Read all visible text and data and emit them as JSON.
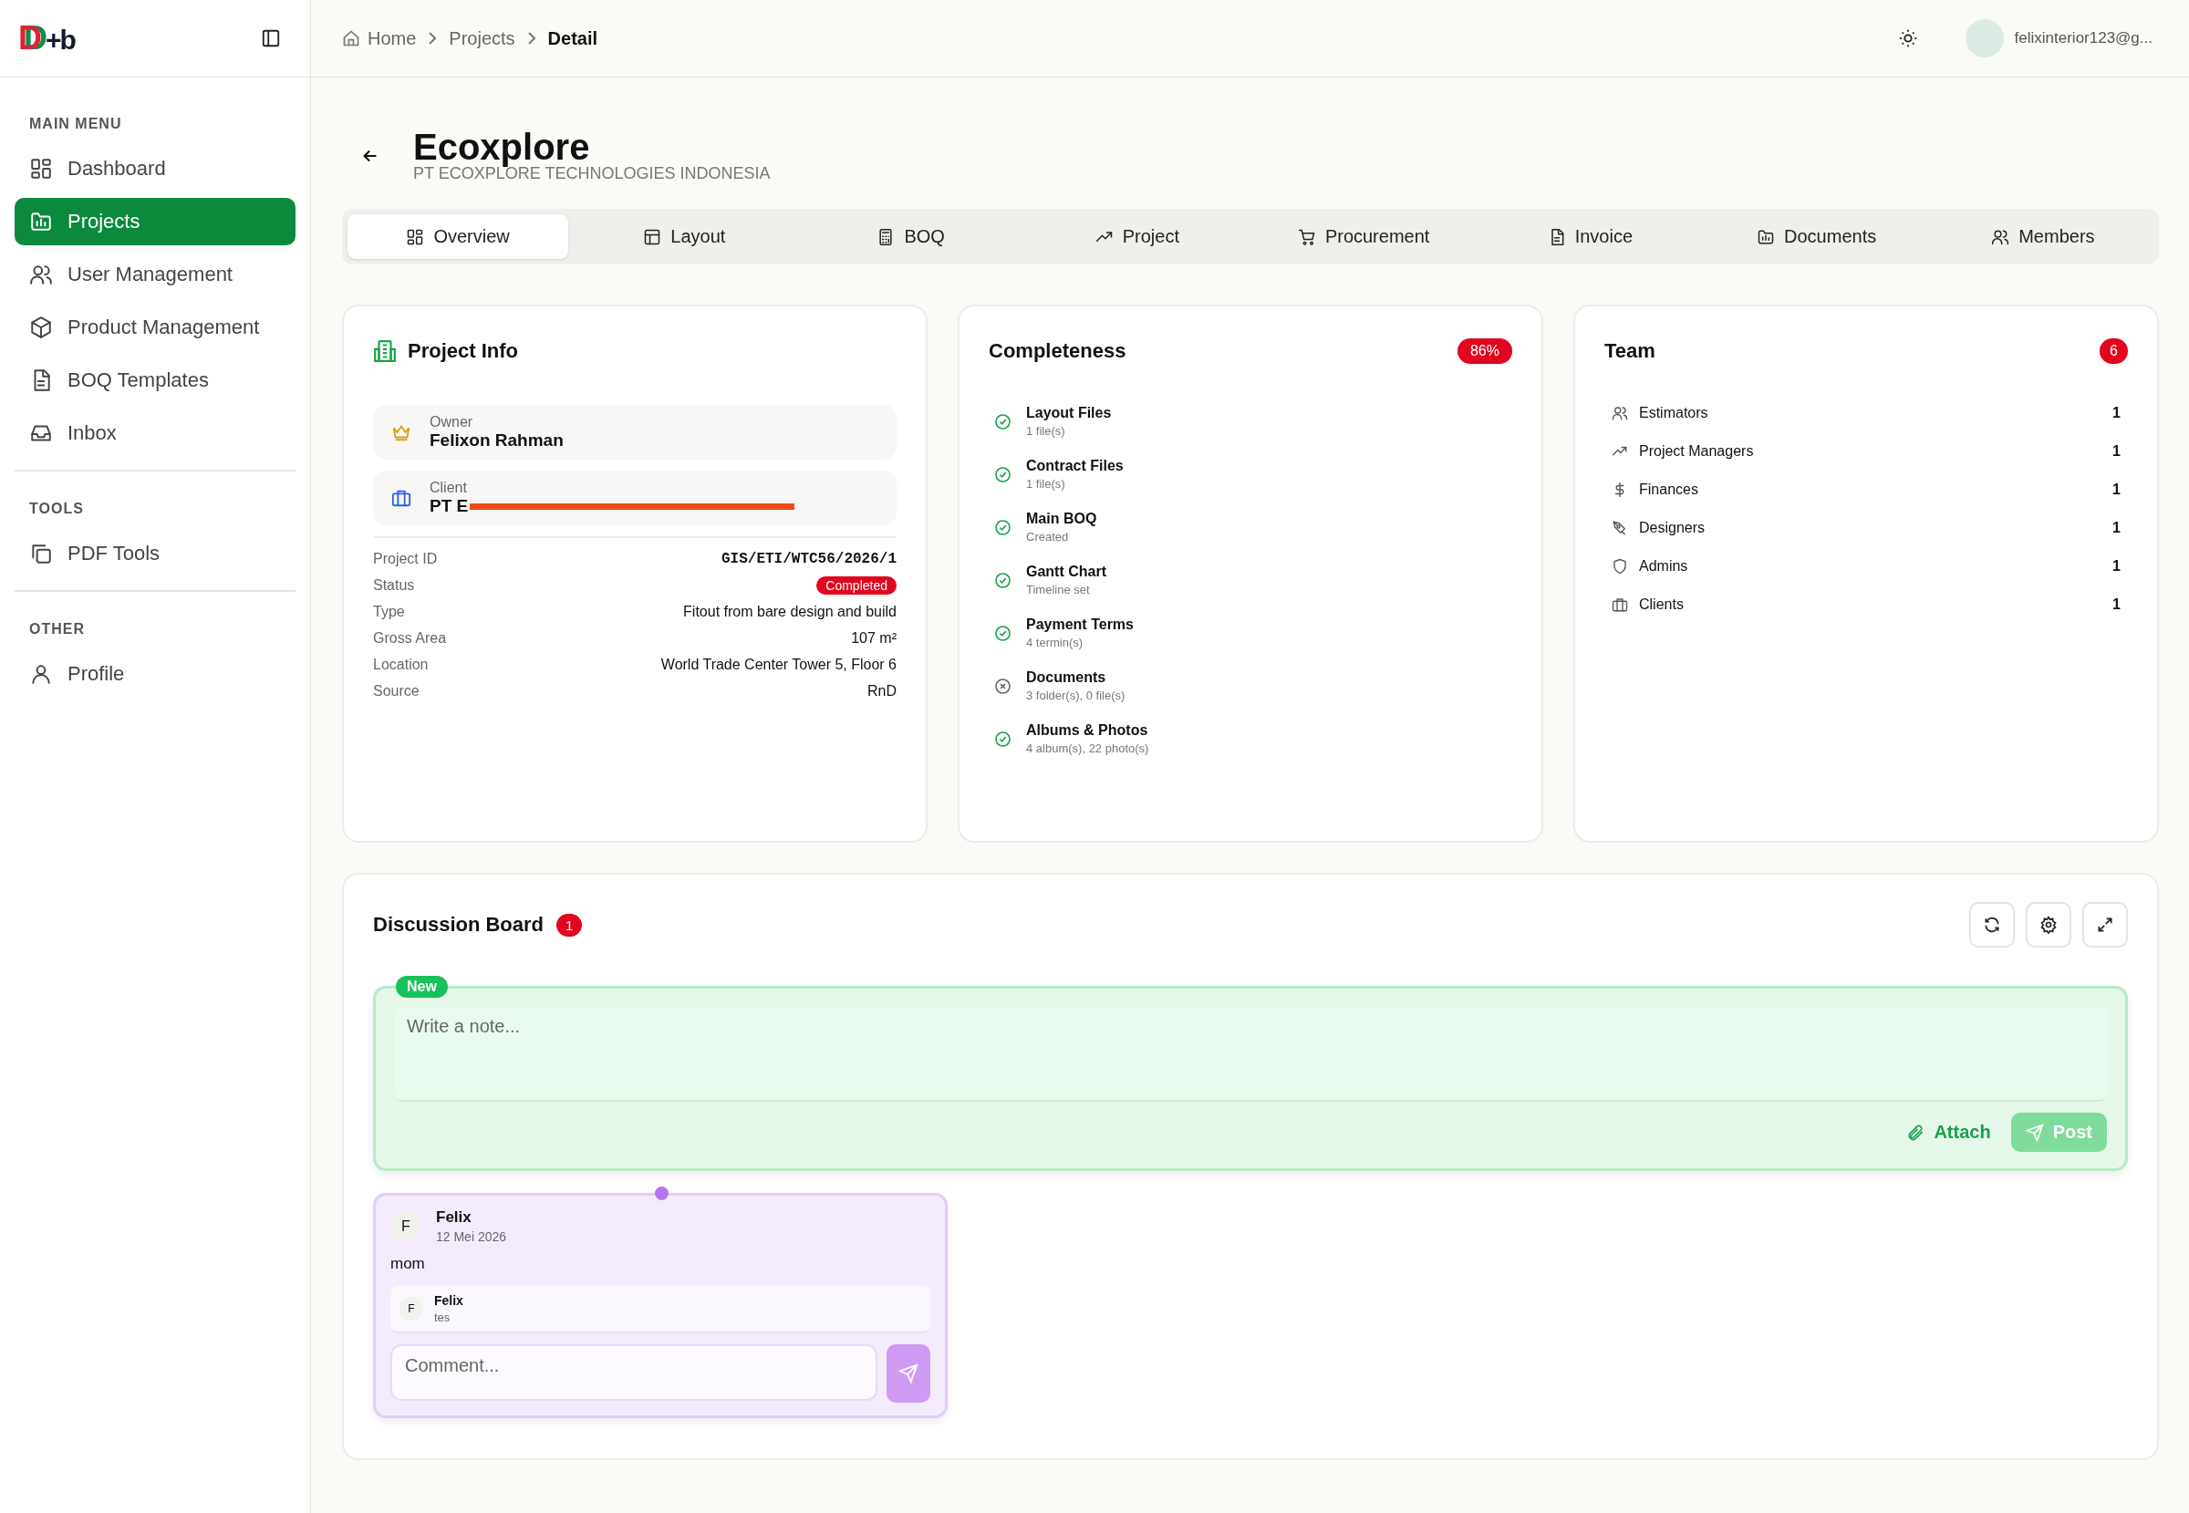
{
  "logo": {
    "mark": "D",
    "suffix": "+b"
  },
  "sidebar": {
    "sections": [
      {
        "heading": "MAIN MENU",
        "items": [
          {
            "label": "Dashboard",
            "selected": false
          },
          {
            "label": "Projects",
            "selected": true
          },
          {
            "label": "User Management",
            "selected": false
          },
          {
            "label": "Product Management",
            "selected": false
          },
          {
            "label": "BOQ Templates",
            "selected": false
          },
          {
            "label": "Inbox",
            "selected": false
          }
        ]
      },
      {
        "heading": "TOOLS",
        "items": [
          {
            "label": "PDF Tools",
            "selected": false
          }
        ]
      },
      {
        "heading": "OTHER",
        "items": [
          {
            "label": "Profile",
            "selected": false
          }
        ]
      }
    ]
  },
  "breadcrumb": [
    {
      "label": "Home",
      "current": false
    },
    {
      "label": "Projects",
      "current": false
    },
    {
      "label": "Detail",
      "current": true
    }
  ],
  "user": {
    "email": "felixinterior123@g..."
  },
  "project": {
    "title": "Ecoxplore",
    "subtitle": "PT ECOXPLORE TECHNOLOGIES INDONESIA"
  },
  "tabs": [
    {
      "label": "Overview",
      "selected": true
    },
    {
      "label": "Layout",
      "selected": false
    },
    {
      "label": "BOQ",
      "selected": false
    },
    {
      "label": "Project",
      "selected": false
    },
    {
      "label": "Procurement",
      "selected": false
    },
    {
      "label": "Invoice",
      "selected": false
    },
    {
      "label": "Documents",
      "selected": false
    },
    {
      "label": "Members",
      "selected": false
    }
  ],
  "project_info": {
    "title": "Project Info",
    "owner": {
      "label": "Owner",
      "value": "Felixon Rahman"
    },
    "client": {
      "label": "Client",
      "value": "PT E"
    },
    "fields": [
      {
        "label": "Project ID",
        "value": "GIS/ETI/WTC56/2026/1",
        "kind": "mono"
      },
      {
        "label": "Status",
        "value": "Completed",
        "kind": "badge"
      },
      {
        "label": "Type",
        "value": "Fitout from bare design and build",
        "kind": "text"
      },
      {
        "label": "Gross Area",
        "value": "107 m²",
        "kind": "text"
      },
      {
        "label": "Location",
        "value": "World Trade Center Tower 5, Floor 6",
        "kind": "text"
      },
      {
        "label": "Source",
        "value": "RnD",
        "kind": "text"
      }
    ]
  },
  "completeness": {
    "title": "Completeness",
    "badge": "86%",
    "items": [
      {
        "title": "Layout Files",
        "detail": "1 file(s)",
        "done": true
      },
      {
        "title": "Contract Files",
        "detail": "1 file(s)",
        "done": true
      },
      {
        "title": "Main BOQ",
        "detail": "Created",
        "done": true
      },
      {
        "title": "Gantt Chart",
        "detail": "Timeline set",
        "done": true
      },
      {
        "title": "Payment Terms",
        "detail": "4 termin(s)",
        "done": true
      },
      {
        "title": "Documents",
        "detail": "3 folder(s), 0 file(s)",
        "done": false
      },
      {
        "title": "Albums & Photos",
        "detail": "4 album(s), 22 photo(s)",
        "done": true
      }
    ]
  },
  "team": {
    "title": "Team",
    "count": "6",
    "roles": [
      {
        "label": "Estimators",
        "count": "1"
      },
      {
        "label": "Project Managers",
        "count": "1"
      },
      {
        "label": "Finances",
        "count": "1"
      },
      {
        "label": "Designers",
        "count": "1"
      },
      {
        "label": "Admins",
        "count": "1"
      },
      {
        "label": "Clients",
        "count": "1"
      }
    ]
  },
  "discussion": {
    "title": "Discussion Board",
    "count": "1",
    "composer": {
      "badge": "New",
      "placeholder": "Write a note...",
      "attach": "Attach",
      "post": "Post"
    },
    "notes": [
      {
        "avatar": "F",
        "author": "Felix",
        "date": "12 Mei 2026",
        "body": "mom",
        "comments": [
          {
            "avatar": "F",
            "author": "Felix",
            "text": "tes"
          }
        ],
        "comment_placeholder": "Comment..."
      }
    ]
  }
}
